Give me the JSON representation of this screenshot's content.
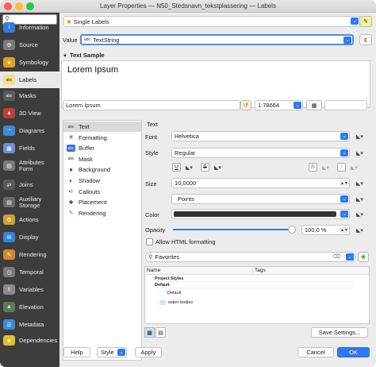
{
  "window": {
    "title": "Layer Properties — N50_Stedsnavn_tekstplassering — Labels"
  },
  "sidebar": {
    "search_placeholder": "",
    "items": [
      {
        "label": "Information",
        "icon": "info-icon"
      },
      {
        "label": "Source",
        "icon": "source-icon"
      },
      {
        "label": "Symbology",
        "icon": "symbology-icon"
      },
      {
        "label": "Labels",
        "icon": "labels-icon",
        "active": true
      },
      {
        "label": "Masks",
        "icon": "masks-icon"
      },
      {
        "label": "3D View",
        "icon": "3d-view-icon"
      },
      {
        "label": "Diagrams",
        "icon": "diagrams-icon"
      },
      {
        "label": "Fields",
        "icon": "fields-icon"
      },
      {
        "label": "Attributes Form",
        "icon": "attributes-form-icon"
      },
      {
        "label": "Joins",
        "icon": "joins-icon"
      },
      {
        "label": "Auxiliary Storage",
        "icon": "auxiliary-storage-icon"
      },
      {
        "label": "Actions",
        "icon": "actions-icon"
      },
      {
        "label": "Display",
        "icon": "display-icon"
      },
      {
        "label": "Rendering",
        "icon": "rendering-icon"
      },
      {
        "label": "Temporal",
        "icon": "temporal-icon"
      },
      {
        "label": "Variables",
        "icon": "variables-icon"
      },
      {
        "label": "Elevation",
        "icon": "elevation-icon"
      },
      {
        "label": "Metadata",
        "icon": "metadata-icon"
      },
      {
        "label": "Dependencies",
        "icon": "dependencies-icon"
      }
    ]
  },
  "labels": {
    "mode": "Single Labels",
    "value_label": "Value",
    "value_badge": "abc",
    "value_field": "TextString",
    "text_sample_heading": "Text Sample",
    "sample_text": "Lorem Ipsum",
    "preview_input": "Lorem Ipsum",
    "scale": "1:78664"
  },
  "tree": {
    "items": [
      "Text",
      "Formatting",
      "Buffer",
      "Mask",
      "Background",
      "Shadow",
      "Callouts",
      "Placement",
      "Rendering"
    ]
  },
  "text_panel": {
    "heading": "Text",
    "font_label": "Font",
    "font_value": "Helvetica",
    "style_label": "Style",
    "style_value": "Regular",
    "underline": "U",
    "strike": "S",
    "bold": "B",
    "italic": "I",
    "size_label": "Size",
    "size_value": "10,0000",
    "unit_value": "Points",
    "color_label": "Color",
    "color_value": "#333333",
    "opacity_label": "Opacity",
    "opacity_value": "100,0 %",
    "opacity_fraction": 1.0,
    "html_label": "Allow HTML formatting"
  },
  "styles": {
    "favorites": "Favorites",
    "col_name": "Name",
    "col_tags": "Tags",
    "groups": [
      "Project Styles",
      "Default"
    ],
    "entries": [
      "Default",
      "water bodies"
    ]
  },
  "footer": {
    "save_settings": "Save Settings...",
    "help": "Help",
    "style": "Style",
    "apply": "Apply",
    "cancel": "Cancel",
    "ok": "OK"
  },
  "colors": {
    "accent": "#2f7af0",
    "sidebar": "#3d3d3d"
  }
}
